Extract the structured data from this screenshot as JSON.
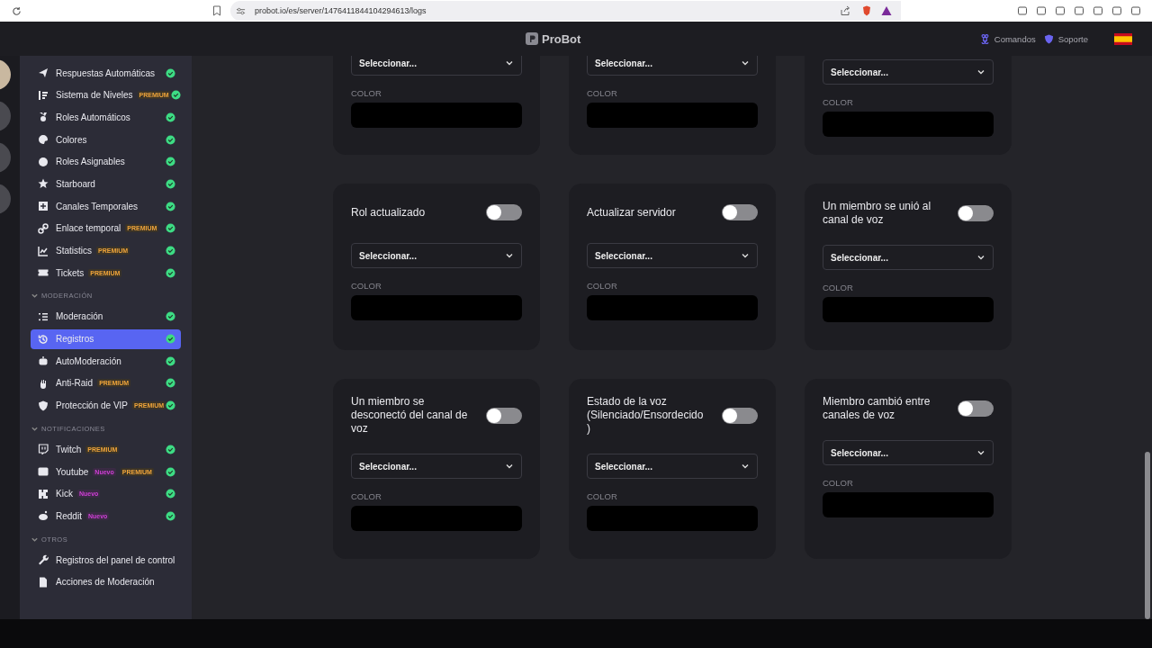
{
  "browser": {
    "url": "probot.io/es/server/1476411844104294613/logs"
  },
  "header": {
    "logo": "ProBot",
    "links": [
      {
        "label": "Comandos"
      },
      {
        "label": "Soporte"
      }
    ]
  },
  "sidebar": {
    "sections": [
      {
        "items": [
          {
            "label": "Respuestas Automáticas",
            "enabled": true,
            "selected": false
          },
          {
            "label": "Sistema de Niveles",
            "enabled": true,
            "selected": false,
            "badges": [
              {
                "kind": "premium",
                "text": "PREMIUM"
              }
            ]
          },
          {
            "label": "Roles Automáticos",
            "enabled": true,
            "selected": false
          },
          {
            "label": "Colores",
            "enabled": true,
            "selected": false
          },
          {
            "label": "Roles Asignables",
            "enabled": true,
            "selected": false
          },
          {
            "label": "Starboard",
            "enabled": true,
            "selected": false
          },
          {
            "label": "Canales Temporales",
            "enabled": true,
            "selected": false
          },
          {
            "label": "Enlace temporal",
            "enabled": true,
            "selected": false,
            "badges": [
              {
                "kind": "premium",
                "text": "PREMIUM"
              }
            ]
          },
          {
            "label": "Statistics",
            "enabled": true,
            "selected": false,
            "badges": [
              {
                "kind": "premium",
                "text": "PREMIUM"
              }
            ]
          },
          {
            "label": "Tickets",
            "enabled": true,
            "selected": false,
            "badges": [
              {
                "kind": "premium",
                "text": "PREMIUM"
              }
            ]
          }
        ]
      },
      {
        "title": "MODERACIÓN",
        "expanded": true,
        "items": [
          {
            "label": "Moderación",
            "enabled": true,
            "selected": false
          },
          {
            "label": "Registros",
            "enabled": true,
            "selected": true
          },
          {
            "label": "AutoModeración",
            "enabled": true,
            "selected": false
          },
          {
            "label": "Anti-Raid",
            "enabled": true,
            "selected": false,
            "badges": [
              {
                "kind": "premium",
                "text": "PREMIUM"
              }
            ]
          },
          {
            "label": "Protección de VIP",
            "enabled": true,
            "selected": false,
            "badges": [
              {
                "kind": "premium",
                "text": "PREMIUM"
              }
            ]
          }
        ]
      },
      {
        "title": "NOTIFICACIONES",
        "expanded": true,
        "items": [
          {
            "label": "Twitch",
            "enabled": true,
            "selected": false,
            "badges": [
              {
                "kind": "premium",
                "text": "PREMIUM"
              }
            ]
          },
          {
            "label": "Youtube",
            "enabled": true,
            "selected": false,
            "badges": [
              {
                "kind": "new",
                "text": "Nuevo"
              },
              {
                "kind": "premium",
                "text": "PREMIUM"
              }
            ]
          },
          {
            "label": "Kick",
            "enabled": true,
            "selected": false,
            "badges": [
              {
                "kind": "new",
                "text": "Nuevo"
              }
            ]
          },
          {
            "label": "Reddit",
            "enabled": true,
            "selected": false,
            "badges": [
              {
                "kind": "new",
                "text": "Nuevo"
              }
            ]
          }
        ]
      },
      {
        "title": "OTROS",
        "expanded": true,
        "items": [
          {
            "label": "Registros del panel de control",
            "selected": false
          },
          {
            "label": "Acciones de Moderación",
            "selected": false
          }
        ]
      }
    ]
  },
  "cards": [
    {
      "select": {
        "placeholder": "Seleccionar..."
      },
      "color_label": "COLOR"
    },
    {
      "select": {
        "placeholder": "Seleccionar..."
      },
      "color_label": "COLOR"
    },
    {
      "select": {
        "placeholder": "Seleccionar..."
      },
      "color_label": "COLOR"
    },
    {
      "title": "Rol actualizado",
      "on": false,
      "select": {
        "placeholder": "Seleccionar..."
      },
      "color_label": "COLOR"
    },
    {
      "title": "Actualizar servidor",
      "on": false,
      "select": {
        "placeholder": "Seleccionar..."
      },
      "color_label": "COLOR"
    },
    {
      "title": "Un miembro se unió al canal de voz",
      "on": false,
      "select": {
        "placeholder": "Seleccionar..."
      },
      "color_label": "COLOR"
    },
    {
      "title": "Un miembro se desconectó del canal de voz",
      "on": false,
      "select": {
        "placeholder": "Seleccionar..."
      },
      "color_label": "COLOR"
    },
    {
      "title": "Estado de la voz (Silenciado/Ensordecido)",
      "on": false,
      "select": {
        "placeholder": "Seleccionar..."
      },
      "color_label": "COLOR"
    },
    {
      "title": "Miembro cambió entre canales de voz",
      "on": false,
      "select": {
        "placeholder": "Seleccionar..."
      },
      "color_label": "COLOR"
    }
  ]
}
